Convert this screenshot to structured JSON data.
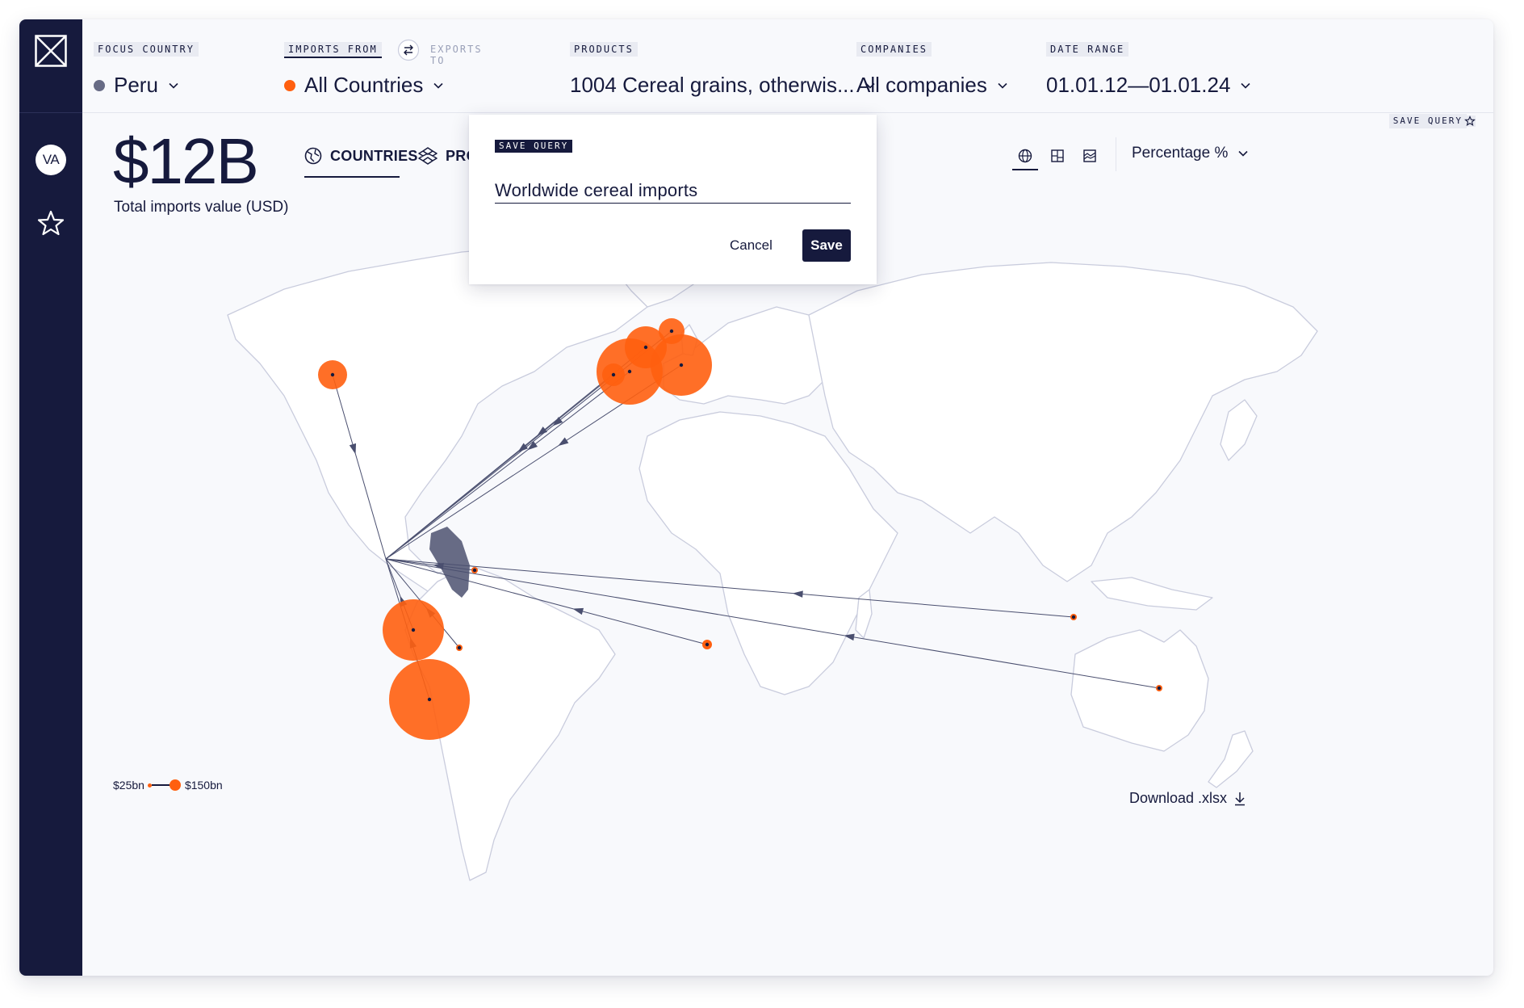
{
  "user": {
    "initials": "VA"
  },
  "filters": {
    "focus_country": {
      "label": "FOCUS COUNTRY",
      "value": "Peru",
      "dot_color": "#676b85"
    },
    "imports_from": {
      "label": "IMPORTS FROM",
      "alt_label": "EXPORTS TO",
      "value": "All Countries",
      "dot_color": "#ff5f0f"
    },
    "products": {
      "label": "PRODUCTS",
      "value": "1004 Cereal grains, otherwis..."
    },
    "companies": {
      "label": "COMPANIES",
      "value": "All companies"
    },
    "date_range": {
      "label": "DATE RANGE",
      "value": "01.01.12—01.01.24"
    }
  },
  "summary": {
    "total_value": "$12B",
    "total_label": "Total imports value (USD)"
  },
  "tabs": [
    {
      "label": "COUNTRIES",
      "active": true
    },
    {
      "label": "PRO",
      "active": false
    }
  ],
  "controls": {
    "save_query": "SAVE QUERY",
    "metric": "Percentage %"
  },
  "legend": {
    "min": "$25bn",
    "max": "$150bn"
  },
  "download": {
    "label": "Download .xlsx"
  },
  "modal": {
    "tag": "SAVE QUERY",
    "query_name": "Worldwide cereal imports",
    "cancel": "Cancel",
    "save": "Save"
  },
  "colors": {
    "navy": "#161a3d",
    "accent": "#ff5f0f",
    "focus": "#676b85",
    "land": "#ffffff",
    "border": "#c9ccdd"
  }
}
